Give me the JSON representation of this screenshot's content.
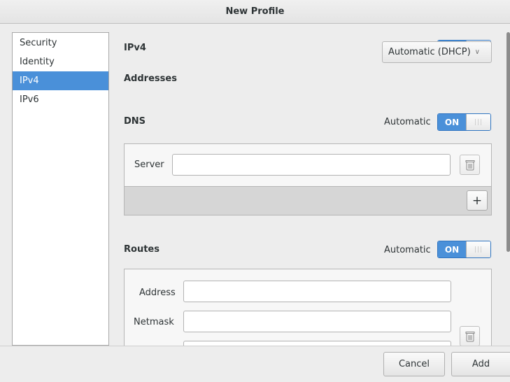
{
  "window": {
    "title": "New Profile"
  },
  "sidebar": {
    "items": [
      {
        "label": "Security",
        "selected": false
      },
      {
        "label": "Identity",
        "selected": false
      },
      {
        "label": "IPv4",
        "selected": true
      },
      {
        "label": "IPv6",
        "selected": false
      }
    ]
  },
  "ipv4": {
    "title": "IPv4",
    "switch_label": "ON",
    "addresses_label": "Addresses",
    "addresses_value": "Automatic (DHCP)"
  },
  "dns": {
    "title": "DNS",
    "automatic_label": "Automatic",
    "switch_label": "ON",
    "server_label": "Server",
    "server_value": "",
    "add_label": "+"
  },
  "routes": {
    "title": "Routes",
    "automatic_label": "Automatic",
    "switch_label": "ON",
    "address_label": "Address",
    "address_value": "",
    "netmask_label": "Netmask",
    "netmask_value": ""
  },
  "footer": {
    "cancel_label": "Cancel",
    "add_label": "Add"
  },
  "colors": {
    "accent": "#4a90d9",
    "background": "#ededed"
  }
}
